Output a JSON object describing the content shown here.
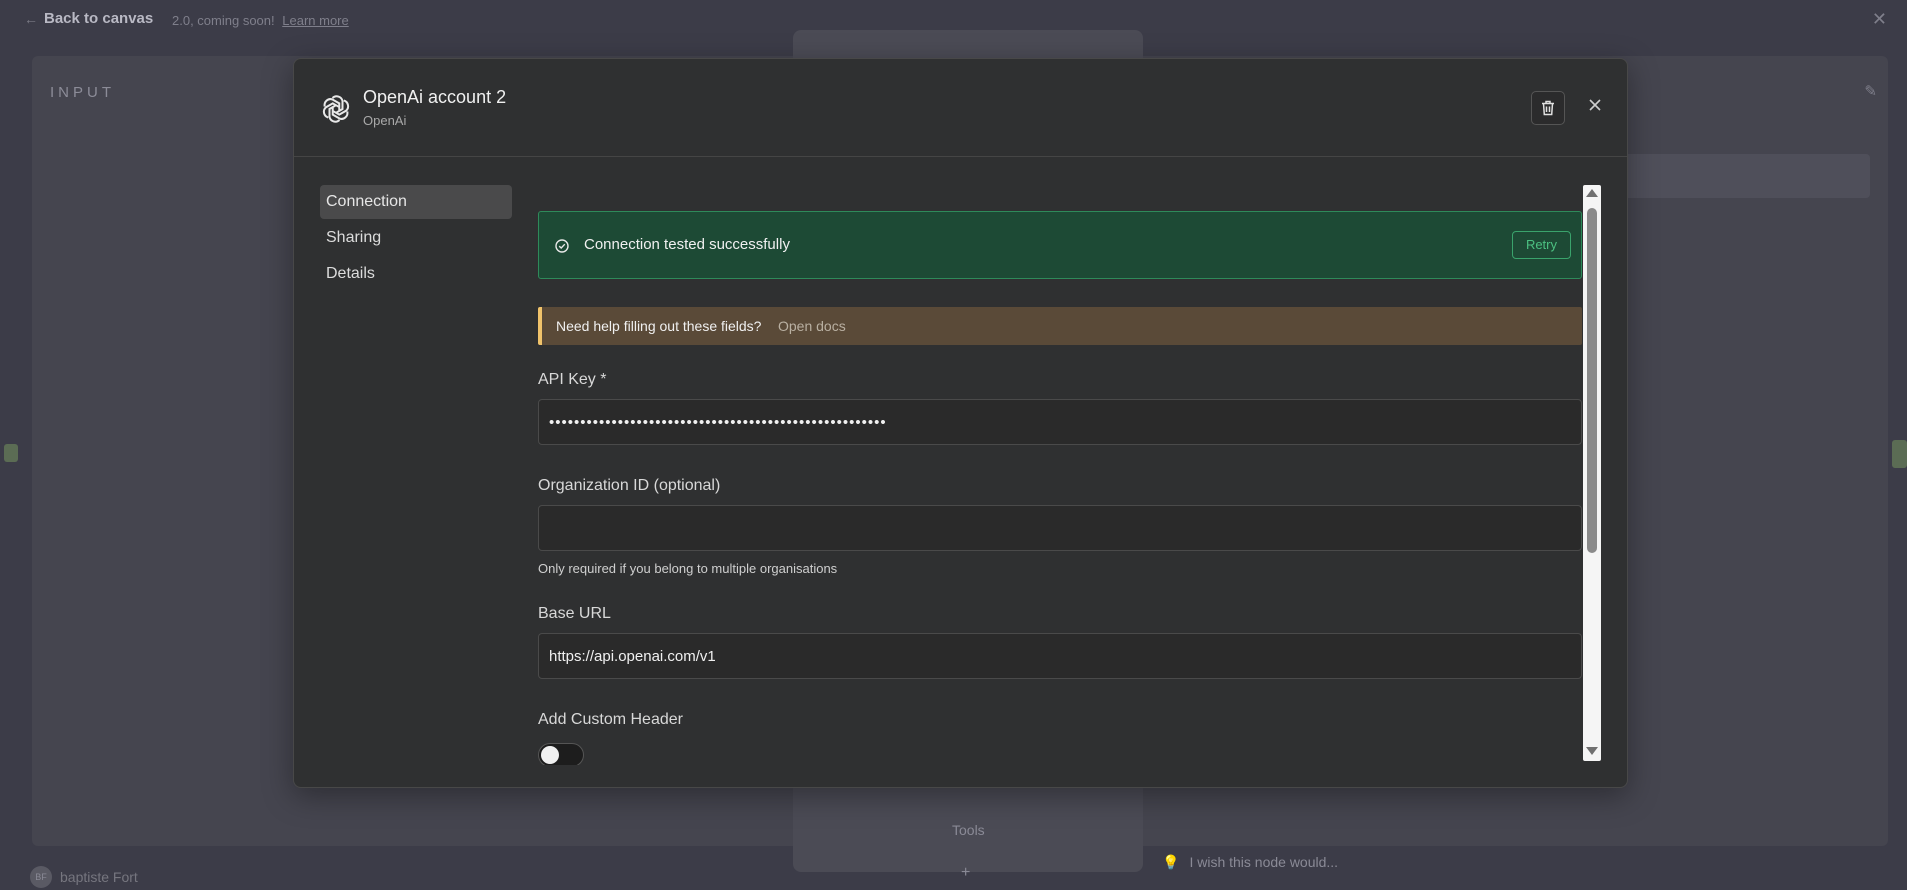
{
  "background": {
    "back_label": "Back to canvas",
    "notice_text": "2.0, coming soon!",
    "notice_link": "Learn more",
    "input_label": "INPUT",
    "tools_label": "Tools",
    "wish_text": "I wish this node would...",
    "user_initials": "BF",
    "user_name": "baptiste Fort"
  },
  "modal": {
    "title": "OpenAi account 2",
    "subtitle": "OpenAi",
    "nav": [
      {
        "label": "Connection",
        "active": true
      },
      {
        "label": "Sharing",
        "active": false
      },
      {
        "label": "Details",
        "active": false
      }
    ],
    "success": {
      "text": "Connection tested successfully",
      "retry_label": "Retry"
    },
    "help": {
      "text": "Need help filling out these fields?",
      "link": "Open docs"
    },
    "fields": {
      "api_key": {
        "label": "API Key *",
        "value": "••••••••••••••••••••••••••••••••••••••••••••••••••••••"
      },
      "org_id": {
        "label": "Organization ID (optional)",
        "value": "",
        "hint": "Only required if you belong to multiple organisations"
      },
      "base_url": {
        "label": "Base URL",
        "value": "https://api.openai.com/v1"
      },
      "custom_header": {
        "label": "Add Custom Header",
        "enabled": false
      }
    }
  },
  "colors": {
    "success_bg": "#1d4a35",
    "success_border": "#2e8a5a",
    "retry_accent": "#4cc081",
    "help_bg": "#5a4a38",
    "help_accent": "#f0c36b"
  }
}
